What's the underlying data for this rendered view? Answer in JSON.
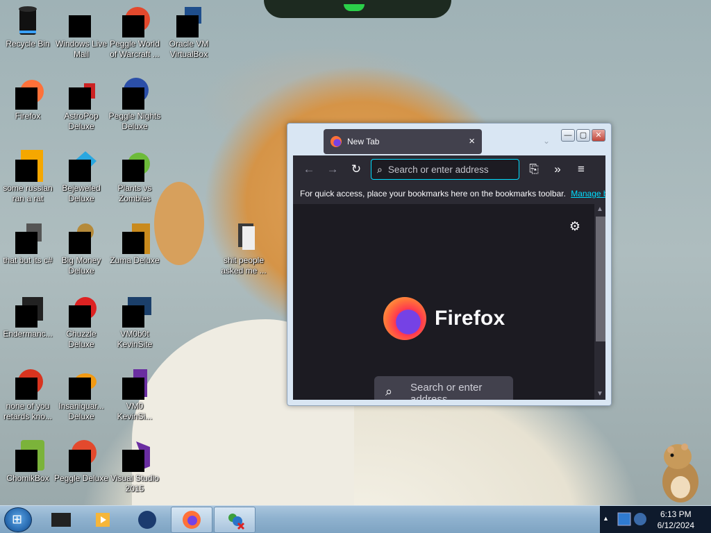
{
  "desktop": {
    "icons": [
      {
        "label": "Recycle Bin",
        "icon": "recycle-bin-icon"
      },
      {
        "label": "Windows Live\nMail",
        "icon": "mail-icon"
      },
      {
        "label": "Peggle World\nof Warcraft ...",
        "icon": "peggle-icon"
      },
      {
        "label": "Oracle VM\nVirtualBox",
        "icon": "virtualbox-icon"
      },
      {
        "label": "Firefox",
        "icon": "firefox-icon"
      },
      {
        "label": "AstroPop\nDeluxe",
        "icon": "astropop-icon"
      },
      {
        "label": "Peggle Nights\nDeluxe",
        "icon": "peggle-nights-icon"
      },
      {
        "label": "some russian\nran a rat",
        "icon": "folder-icon"
      },
      {
        "label": "Bejeweled\nDeluxe",
        "icon": "bejeweled-icon"
      },
      {
        "label": "Plants vs\nZombies",
        "icon": "plants-vs-zombies-icon"
      },
      {
        "label": "that but its c#",
        "icon": "files-icon"
      },
      {
        "label": "Big Money\nDeluxe",
        "icon": "money-bag-icon"
      },
      {
        "label": "Zuma Deluxe",
        "icon": "zuma-icon"
      },
      {
        "label": "shit people\nasked me ...",
        "icon": "document-folder-icon"
      },
      {
        "label": "Endermanc...",
        "icon": "terminal-icon"
      },
      {
        "label": "Chuzzle\nDeluxe",
        "icon": "chuzzle-icon"
      },
      {
        "label": "VM0b0t\nKevinSite",
        "icon": "monitor-icon"
      },
      {
        "label": "none of you\nretards kno...",
        "icon": "app-icon"
      },
      {
        "label": "Insaniquar...\nDeluxe",
        "icon": "fish-icon"
      },
      {
        "label": "VM0\nKevinSi...",
        "icon": "vs-icon"
      },
      {
        "label": "ChomikBox",
        "icon": "hamster-box-icon"
      },
      {
        "label": "Peggle Deluxe",
        "icon": "peggle-deluxe-icon"
      },
      {
        "label": "Visual Studio\n2015",
        "icon": "visual-studio-icon"
      }
    ]
  },
  "browser": {
    "tab_title": "New Tab",
    "close_tab": "×",
    "tab_list": "⌄",
    "window_buttons": {
      "minimize": "—",
      "maximize": "▢",
      "close": "✕"
    },
    "toolbar": {
      "back": "←",
      "forward": "→",
      "reload": "↻",
      "url_placeholder": "Search or enter address",
      "extensions": "⎘",
      "overflow": "»",
      "menu": "≡"
    },
    "bookmarks_bar": {
      "text": "For quick access, place your bookmarks here on the bookmarks toolbar.",
      "link": "Manage bo"
    },
    "content": {
      "settings": "⚙",
      "logo_text": "Firefox",
      "search_placeholder": "Search or enter address"
    }
  },
  "taskbar": {
    "clock_time": "6:13 PM",
    "clock_date": "6/12/2024",
    "tray_expand": "▲"
  },
  "colors": {
    "firefox_accent": "#00ddff",
    "firefox_bg": "#1c1b22",
    "taskbar": "#8fb2cf"
  }
}
